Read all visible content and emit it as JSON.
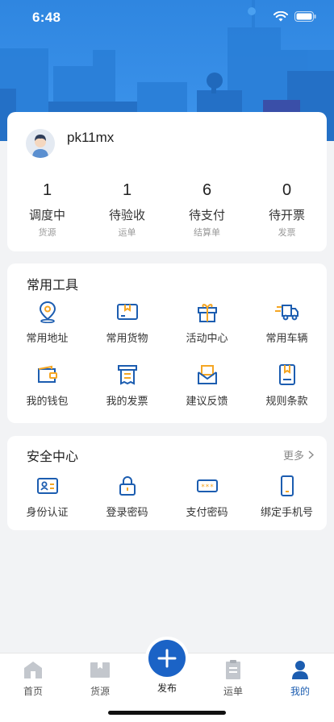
{
  "status_bar": {
    "time": "6:48"
  },
  "profile": {
    "username": "pk11mx",
    "stats": [
      {
        "value": "1",
        "label": "调度中",
        "sub": "货源"
      },
      {
        "value": "1",
        "label": "待验收",
        "sub": "运单"
      },
      {
        "value": "6",
        "label": "待支付",
        "sub": "结算单"
      },
      {
        "value": "0",
        "label": "待开票",
        "sub": "发票"
      }
    ]
  },
  "tools": {
    "title": "常用工具",
    "items": [
      {
        "label": "常用地址",
        "icon": "location-pin-icon"
      },
      {
        "label": "常用货物",
        "icon": "package-icon"
      },
      {
        "label": "活动中心",
        "icon": "gift-icon"
      },
      {
        "label": "常用车辆",
        "icon": "truck-icon"
      },
      {
        "label": "我的钱包",
        "icon": "wallet-icon"
      },
      {
        "label": "我的发票",
        "icon": "invoice-icon"
      },
      {
        "label": "建议反馈",
        "icon": "envelope-icon"
      },
      {
        "label": "规则条款",
        "icon": "bookmark-doc-icon"
      }
    ]
  },
  "security": {
    "title": "安全中心",
    "more": "更多",
    "items": [
      {
        "label": "身份认证",
        "icon": "id-card-icon"
      },
      {
        "label": "登录密码",
        "icon": "lock-icon"
      },
      {
        "label": "支付密码",
        "icon": "password-dots-icon"
      },
      {
        "label": "绑定手机号",
        "icon": "phone-icon"
      }
    ]
  },
  "tabbar": {
    "items": [
      {
        "label": "首页",
        "icon": "home-icon"
      },
      {
        "label": "货源",
        "icon": "cargo-icon"
      },
      {
        "label": "发布",
        "icon": "plus-icon"
      },
      {
        "label": "运单",
        "icon": "clipboard-icon"
      },
      {
        "label": "我的",
        "icon": "person-icon"
      }
    ],
    "active": "我的"
  },
  "colors": {
    "accent": "#1c5db0",
    "header": "#3a8ee6",
    "icon_orange": "#f5a623"
  }
}
